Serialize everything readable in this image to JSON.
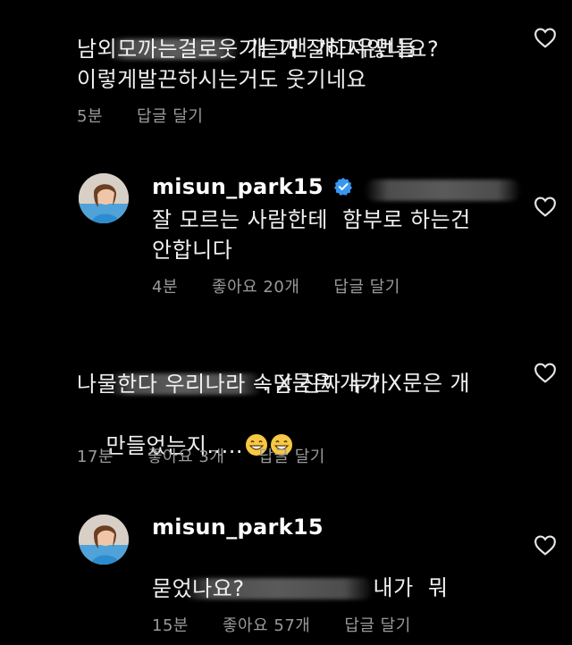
{
  "comments": [
    {
      "username": "",
      "text_line1_suffix": "개그맨 개그우먼들",
      "text_line2": "남외모까는걸로웃기는거 잘하지않나요?",
      "text_line3": "이렇게발끈하시는거도 웃기네요",
      "time": "5분",
      "likes": "",
      "reply": "답글 달기"
    },
    {
      "username": "misun_park15",
      "verified": true,
      "text_line1": "잘 모르는 사람한테  함부로 하는건",
      "text_line2": "안합니다",
      "time": "4분",
      "likes": "좋아요 20개",
      "reply": "답글 달기"
    },
    {
      "username": "",
      "text_line1_suffix": ". X묻은 개가 X문은 개",
      "text_line2": "나물한다 우리나라 속담 진짜 누가",
      "text_line3": "만들었는지.....",
      "time": "17분",
      "likes": "좋아요 3개",
      "reply": "답글 달기"
    },
    {
      "username": "misun_park15",
      "text_line1_suffix": "내가  뭐",
      "text_line2": "묻었나요?",
      "time": "15분",
      "likes": "좋아요 57개",
      "reply": "답글 달기"
    }
  ],
  "icons": {
    "like": "heart-outline-icon",
    "verified": "verified-badge-icon",
    "emoji": "grinning-face-emoji"
  },
  "colors": {
    "background": "#000000",
    "text": "#f0f0f0",
    "meta": "#9a9a9a",
    "verified": "#3897f0"
  }
}
